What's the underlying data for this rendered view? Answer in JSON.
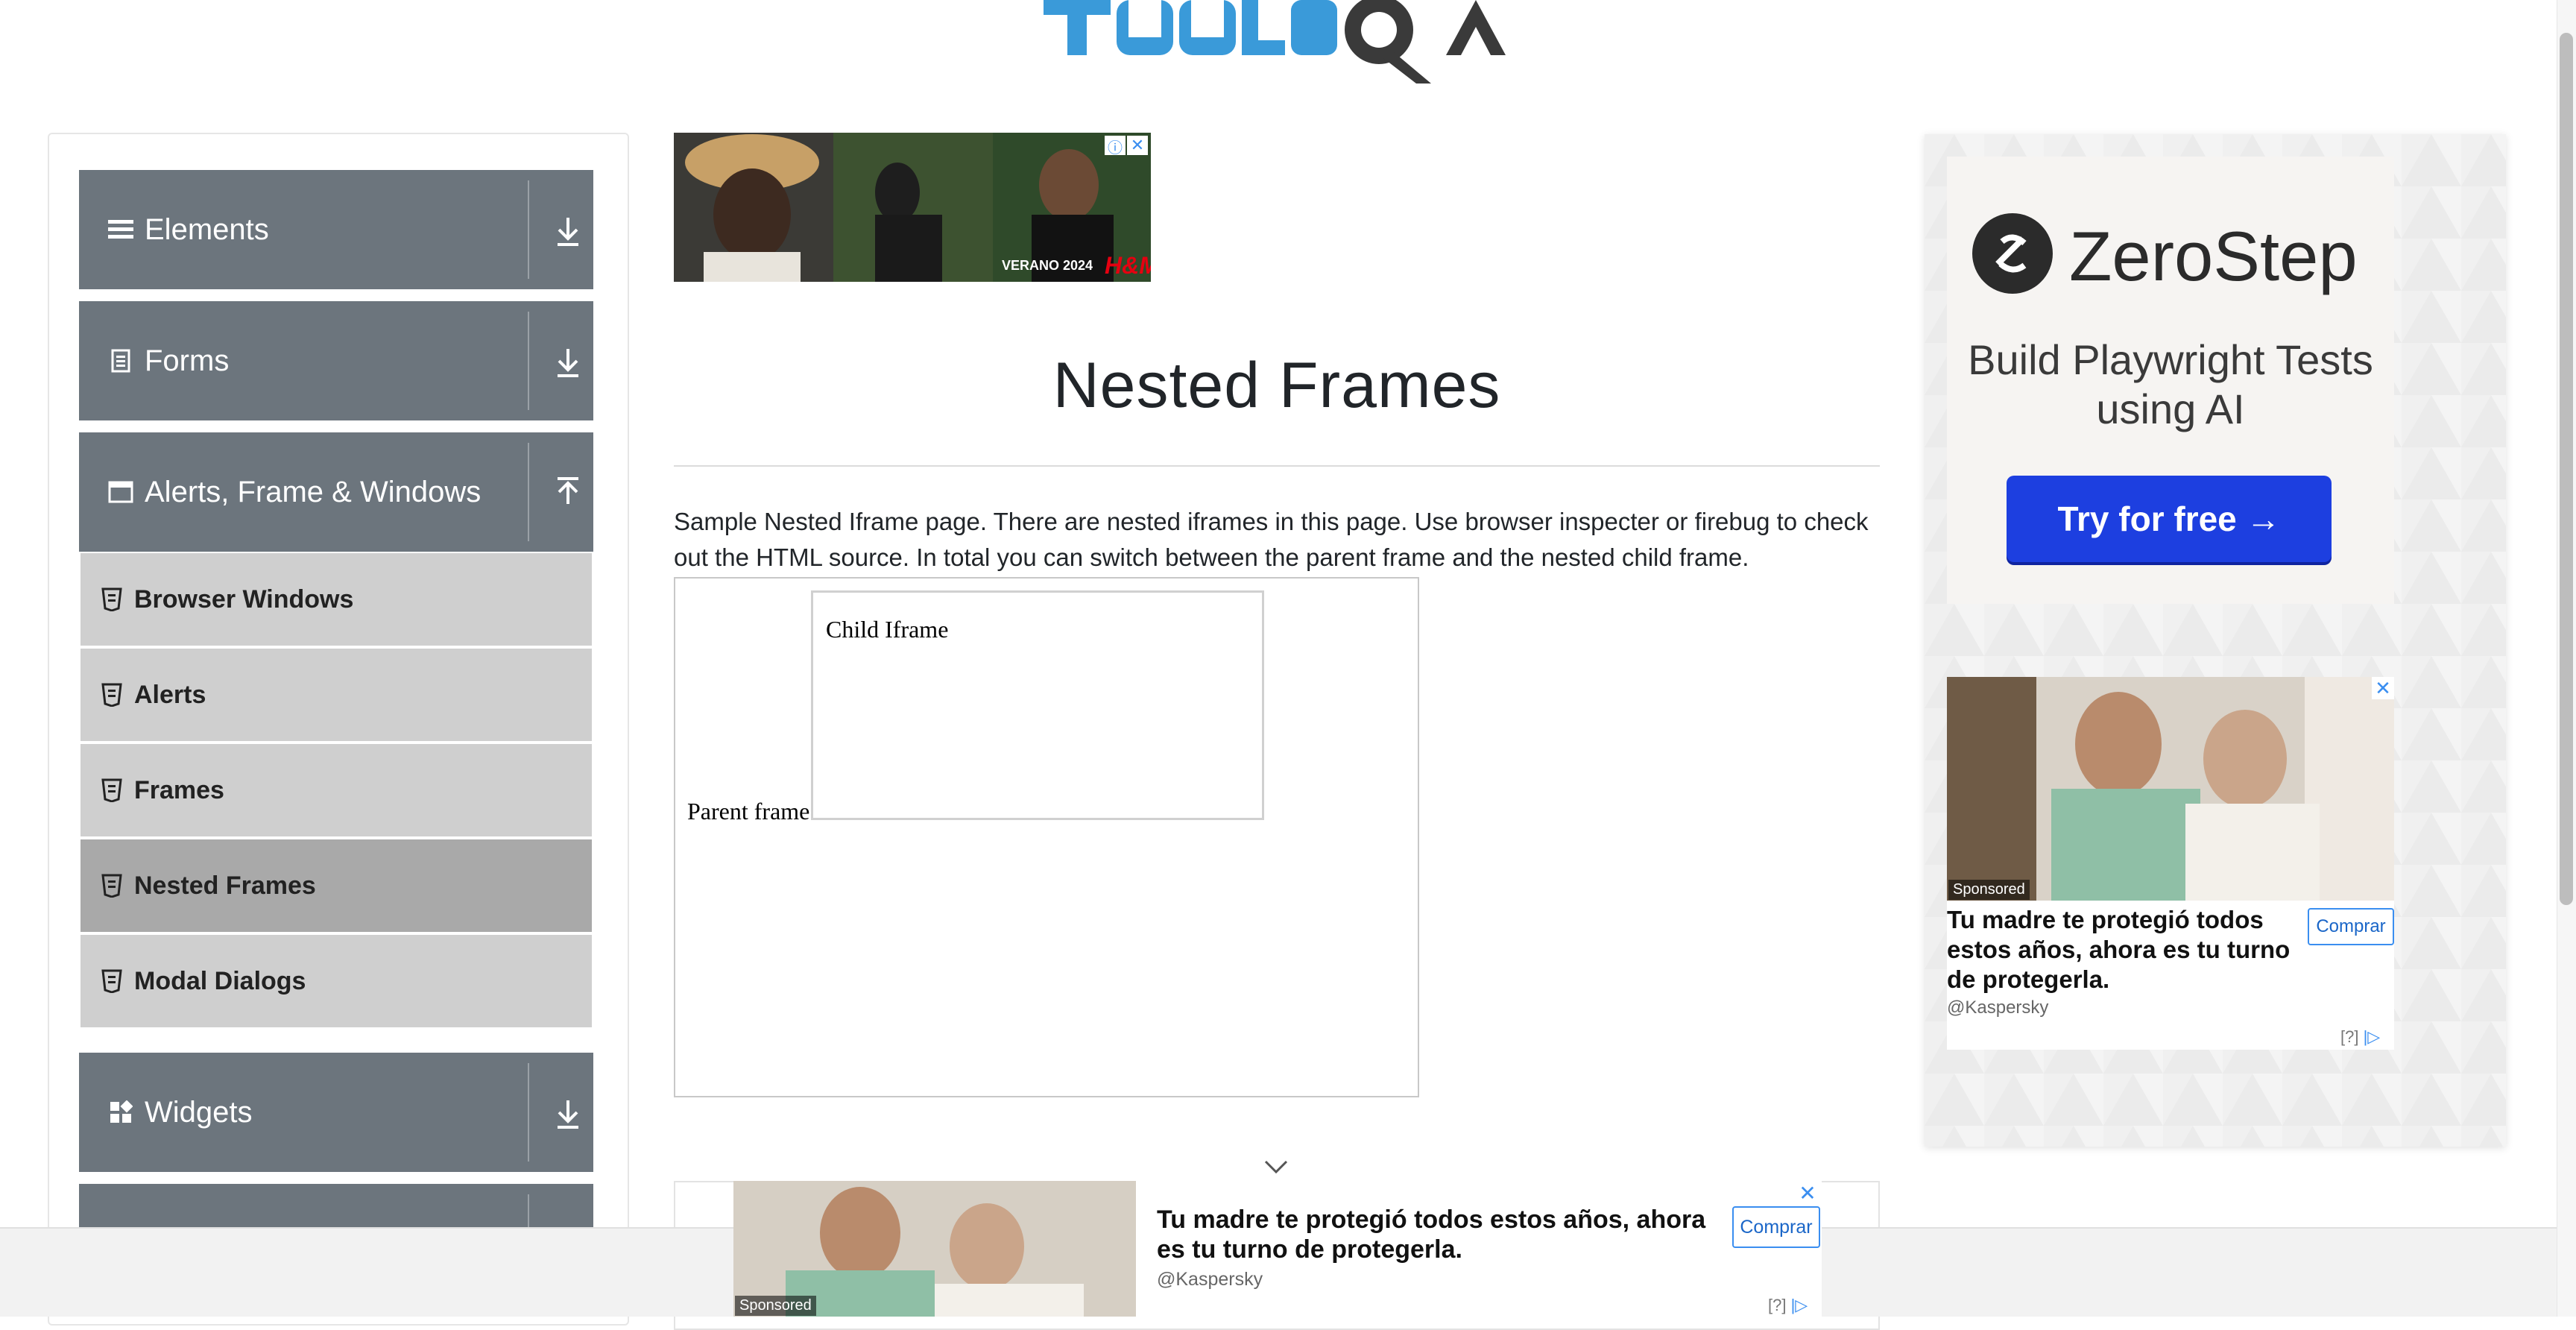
{
  "header": {
    "logo_text": "TOOLSQA"
  },
  "sidebar": {
    "groups": [
      {
        "label": "Elements",
        "icon": "hamburger-icon",
        "expanded": false
      },
      {
        "label": "Forms",
        "icon": "document-icon",
        "expanded": false
      },
      {
        "label": "Alerts, Frame & Windows",
        "icon": "window-icon",
        "expanded": true
      },
      {
        "label": "Widgets",
        "icon": "grid-icon",
        "expanded": false
      }
    ],
    "items": [
      "Browser Windows",
      "Alerts",
      "Frames",
      "Nested Frames",
      "Modal Dialogs"
    ],
    "active_item": "Nested Frames"
  },
  "main": {
    "title": "Nested Frames",
    "description": "Sample Nested Iframe page. There are nested iframes in this page. Use browser inspecter or firebug to check out the HTML source. In total you can switch between the parent frame and the nested child frame.",
    "parent_frame_text": "Parent frame",
    "child_frame_text": "Child Iframe"
  },
  "ads": {
    "top_banner": {
      "caption": "VERANO 2024",
      "brand": "H&M"
    },
    "zerostep": {
      "name": "ZeroStep",
      "tagline": "Build Playwright Tests using AI",
      "cta": "Try for free →"
    },
    "kaspersky": {
      "sponsored": "Sponsored",
      "headline": "Tu madre te protegió todos estos años, ahora es tu turno de protegerla.",
      "handle": "@Kaspersky",
      "buy": "Comprar",
      "adchoices": "[?]"
    }
  },
  "colors": {
    "sidebar_header": "#6c757d",
    "sidebar_item": "#cfcfcf",
    "sidebar_active": "#a9a9a9",
    "cta_blue": "#1d3fe0",
    "logo_blue": "#3a9ad9"
  }
}
